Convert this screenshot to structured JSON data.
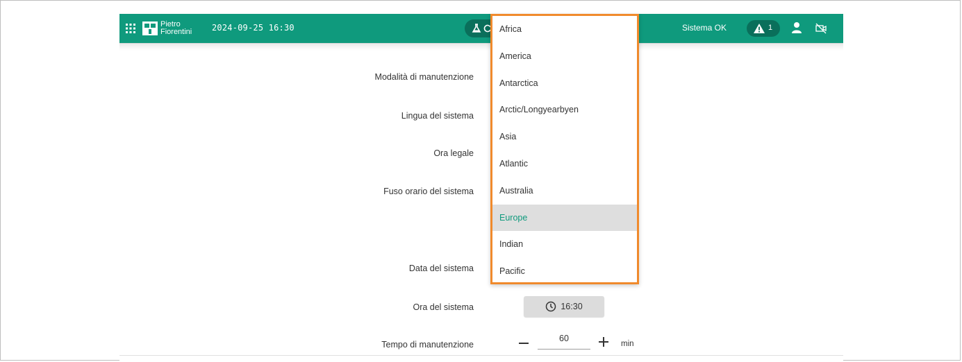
{
  "topbar": {
    "logo_line1": "Pietro",
    "logo_line2": "Fiorentini",
    "datetime": "2024-09-25 16:30",
    "status": "Sistema OK",
    "alarm_count": "1"
  },
  "form": {
    "maintenance_mode_label": "Modalità di manutenzione",
    "language_label": "Lingua del sistema",
    "dst_label": "Ora legale",
    "timezone_label": "Fuso orario del sistema",
    "date_label": "Data del sistema",
    "time_label": "Ora del sistema",
    "time_value": "16:30",
    "maintenance_time_label": "Tempo di manutenzione",
    "maintenance_time_value": "60",
    "maintenance_time_unit": "min"
  },
  "timezone_dropdown": {
    "options": [
      "Africa",
      "America",
      "Antarctica",
      "Arctic/Longyearbyen",
      "Asia",
      "Atlantic",
      "Australia",
      "Europe",
      "Indian",
      "Pacific"
    ],
    "selected": "Europe"
  },
  "colors": {
    "accent": "#0f9a7d",
    "accent_dark": "#0a6f5b",
    "highlight_border": "#f08a2c"
  },
  "icons": [
    "apps-grid-icon",
    "flask-icon",
    "sync-icon",
    "warning-icon",
    "user-icon",
    "camera-off-icon",
    "clock-icon",
    "minus-icon",
    "plus-icon"
  ]
}
